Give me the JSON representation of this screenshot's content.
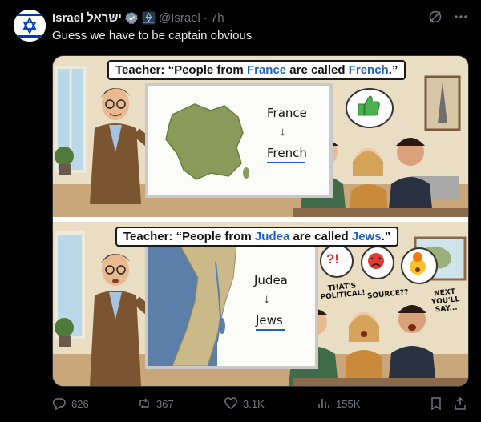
{
  "tweet": {
    "author_name": "Israel",
    "author_name_hebrew": "ישראל",
    "handle": "@Israel",
    "separator": "·",
    "time": "7h",
    "text": "Guess we have to be captain obvious"
  },
  "image": {
    "top_caption": {
      "prefix": "Teacher: “People from ",
      "place": "France",
      "middle": " are called ",
      "demonym": "French",
      "suffix": ".”"
    },
    "top_board": {
      "word1": "France",
      "arrow": "↓",
      "word2": "French"
    },
    "bottom_caption": {
      "prefix": "Teacher: “People from ",
      "place": "Judea",
      "middle": " are called ",
      "demonym": "Jews",
      "suffix": ".”"
    },
    "bottom_board": {
      "word1": "Judea",
      "arrow": "↓",
      "word2": "Jews"
    },
    "bubbles": {
      "angry_text": "?!"
    },
    "student_notes": {
      "note1": "THAT'S\nPOLITICAL!",
      "note2": "SOURCE??",
      "note3": "NEXT\nYOU'LL\nSAY..."
    }
  },
  "actions": {
    "replies": "626",
    "reposts": "367",
    "likes": "3.1K",
    "views": "155K"
  },
  "colors": {
    "accent_blue": "#1d9bf0",
    "muted": "#71767b",
    "caption_highlight": "#1f5fbf"
  }
}
